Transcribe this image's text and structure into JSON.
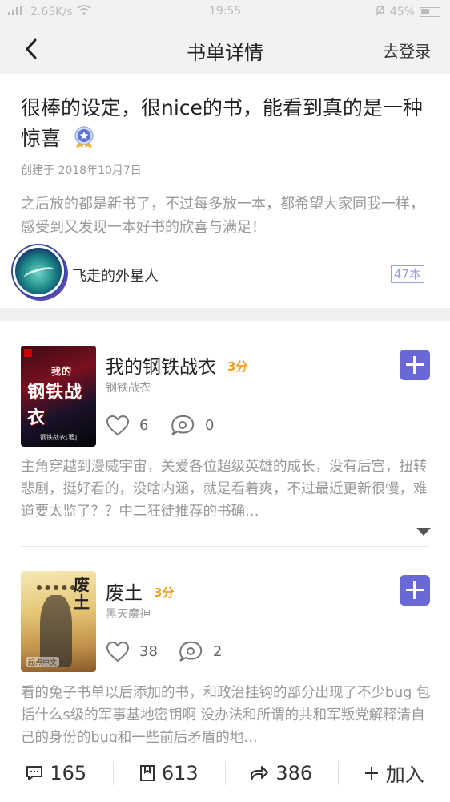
{
  "status_bar": {
    "speed": "2.65K/s",
    "time": "19:55",
    "battery": "45%"
  },
  "nav": {
    "title": "书单详情",
    "login": "去登录"
  },
  "booklist": {
    "title": "很棒的设定，很nice的书，能看到真的是一种惊喜",
    "created": "创建于 2018年10月7日",
    "description": "之后放的都是新书了，不过每多放一本，都希望大家同我一样，感受到又发现一本好书的欣喜与满足！",
    "author": "飞走的外星人",
    "book_count": "47本"
  },
  "books": [
    {
      "title": "我的钢铁战衣",
      "score": "3分",
      "author": "钢铁战衣",
      "likes": "6",
      "comments": "0",
      "review": "主角穿越到漫威宇宙，关爱各位超级英雄的成长，没有后宫，扭转悲剧，挺好看的，没啥内涵，就是看着爽，不过最近更新很慢，难道要太监了？？中二狂徒推荐的书确…",
      "cover_small": "我的",
      "cover_title": "钢铁战衣",
      "cover_sub": "钢铁战衣[著]"
    },
    {
      "title": "废土",
      "score": "3分",
      "author": "黑天魔神",
      "likes": "38",
      "comments": "2",
      "review": "看的兔子书单以后添加的书，和政治挂钩的部分出现了不少bug 包括什么s级的军事基地密钥啊 没办法和所谓的共和军叛党解释清自己的身份的bug和一些前后矛盾的地…",
      "cover_title": "废土",
      "cover_foot": "起点中文"
    }
  ],
  "bottom_bar": {
    "comments": "165",
    "bookmarks": "613",
    "shares": "386",
    "join": "加入"
  },
  "colors": {
    "accent": "#6a68d6",
    "score": "#f39a1e"
  }
}
